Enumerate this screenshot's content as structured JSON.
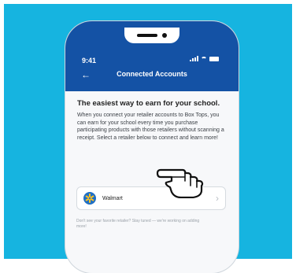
{
  "colors": {
    "background": "#16b4e0",
    "header": "#1452a5",
    "brand_walmart": "#1f6fc5",
    "walmart_spark": "#ffc220"
  },
  "status_bar": {
    "time": "9:41"
  },
  "nav": {
    "title": "Connected Accounts",
    "back_icon": "arrow-left-icon"
  },
  "main": {
    "headline": "The easiest way to earn for your school.",
    "body": "When you connect your retailer accounts to Box Tops, you can earn for your school every time you purchase participating products with those retailers without scanning a receipt. Select a retailer below to connect and learn more!"
  },
  "retailers": [
    {
      "name": "Walmart",
      "icon": "walmart-spark-icon"
    }
  ],
  "footnote": "Don't see your favorite retailer? Stay tuned — we're working on adding more!",
  "overlay": {
    "icon": "pointing-hand-icon"
  }
}
